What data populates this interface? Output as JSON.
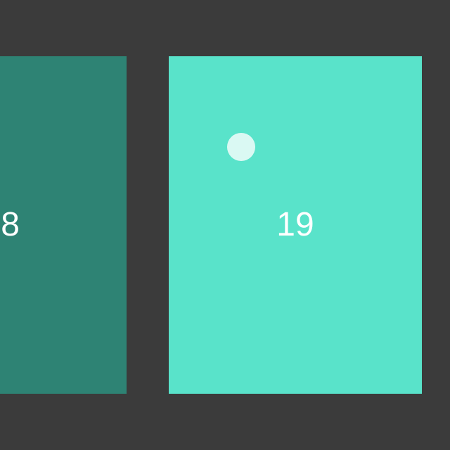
{
  "carousel": {
    "cards": [
      {
        "label": "8",
        "color": "#2e8374"
      },
      {
        "label": "19",
        "color": "#59e3ca"
      }
    ]
  },
  "colors": {
    "background": "#3b3b3b",
    "text": "#ffffff",
    "touch_indicator": "#dff9f4"
  },
  "icons": {
    "touch_indicator": "touch-point-icon"
  }
}
